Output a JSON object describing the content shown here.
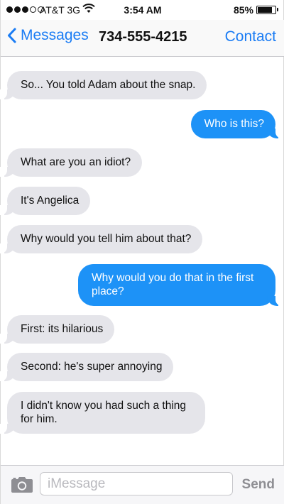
{
  "status_bar": {
    "carrier": "AT&T",
    "network": "3G",
    "time": "3:54 AM",
    "battery": "85%",
    "battery_level": 0.85
  },
  "nav": {
    "back_label": "Messages",
    "title": "734-555-4215",
    "contact_label": "Contact"
  },
  "messages": [
    {
      "direction": "in",
      "text": "So... You told Adam about the snap."
    },
    {
      "direction": "out",
      "text": "Who is this?"
    },
    {
      "direction": "in",
      "text": "What are you an idiot?"
    },
    {
      "direction": "in",
      "text": "It's Angelica"
    },
    {
      "direction": "in",
      "text": "Why would you tell him about that?"
    },
    {
      "direction": "out",
      "text": "Why would you do that in the first place?"
    },
    {
      "direction": "in",
      "text": "First: its hilarious"
    },
    {
      "direction": "in",
      "text": "Second: he's super annoying"
    },
    {
      "direction": "in",
      "text": "I didn't know you had such a thing for him."
    }
  ],
  "input_bar": {
    "placeholder": "iMessage",
    "send_label": "Send"
  },
  "colors": {
    "accent": "#1a7cf4",
    "outgoing_bubble": "#1d92f7",
    "incoming_bubble": "#e5e5ea"
  }
}
